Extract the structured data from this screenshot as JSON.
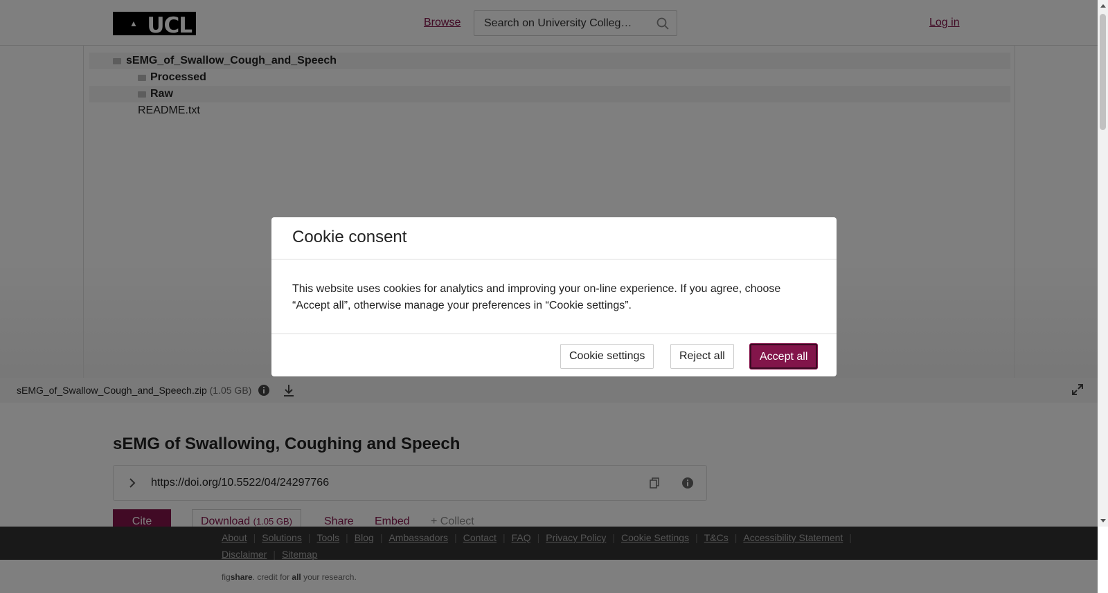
{
  "header": {
    "logo_text": "UCL",
    "browse_label": "Browse",
    "search_placeholder": "Search on University Colleg…",
    "login_label": "Log in"
  },
  "file_tree": {
    "items": [
      {
        "label": "sEMG_of_Swallow_Cough_and_Speech",
        "type": "folder"
      },
      {
        "label": "Processed",
        "type": "folder"
      },
      {
        "label": "Raw",
        "type": "folder"
      },
      {
        "label": "README.txt",
        "type": "file"
      }
    ]
  },
  "file_bar": {
    "filename": "sEMG_of_Swallow_Cough_and_Speech.zip",
    "size": "(1.05 GB)"
  },
  "article": {
    "title": "sEMG of Swallowing, Coughing and Speech",
    "doi_url": "https://doi.org/10.5522/04/24297766",
    "cite_label": "Cite",
    "download_label": "Download",
    "download_size": "(1.05 GB)",
    "share_label": "Share",
    "embed_label": "Embed",
    "collect_label": "+ Collect"
  },
  "footer": {
    "links": [
      "About",
      "Solutions",
      "Tools",
      "Blog",
      "Ambassadors",
      "Contact",
      "FAQ",
      "Privacy Policy",
      "Cookie Settings",
      "T&Cs",
      "Accessibility Statement",
      "Disclaimer",
      "Sitemap"
    ],
    "tagline_pre": "fig",
    "tagline_brand": "share",
    "tagline_mid": ". credit for ",
    "tagline_all": "all",
    "tagline_post": " your research."
  },
  "cookie_modal": {
    "title": "Cookie consent",
    "body": "This website uses cookies for analytics and improving your on-line experience. If you agree, choose “Accept all”, otherwise manage your preferences in “Cookie settings”.",
    "settings_label": "Cookie settings",
    "reject_label": "Reject all",
    "accept_label": "Accept all"
  },
  "colors": {
    "brand": "#82154a",
    "footer_bg": "#333333"
  }
}
